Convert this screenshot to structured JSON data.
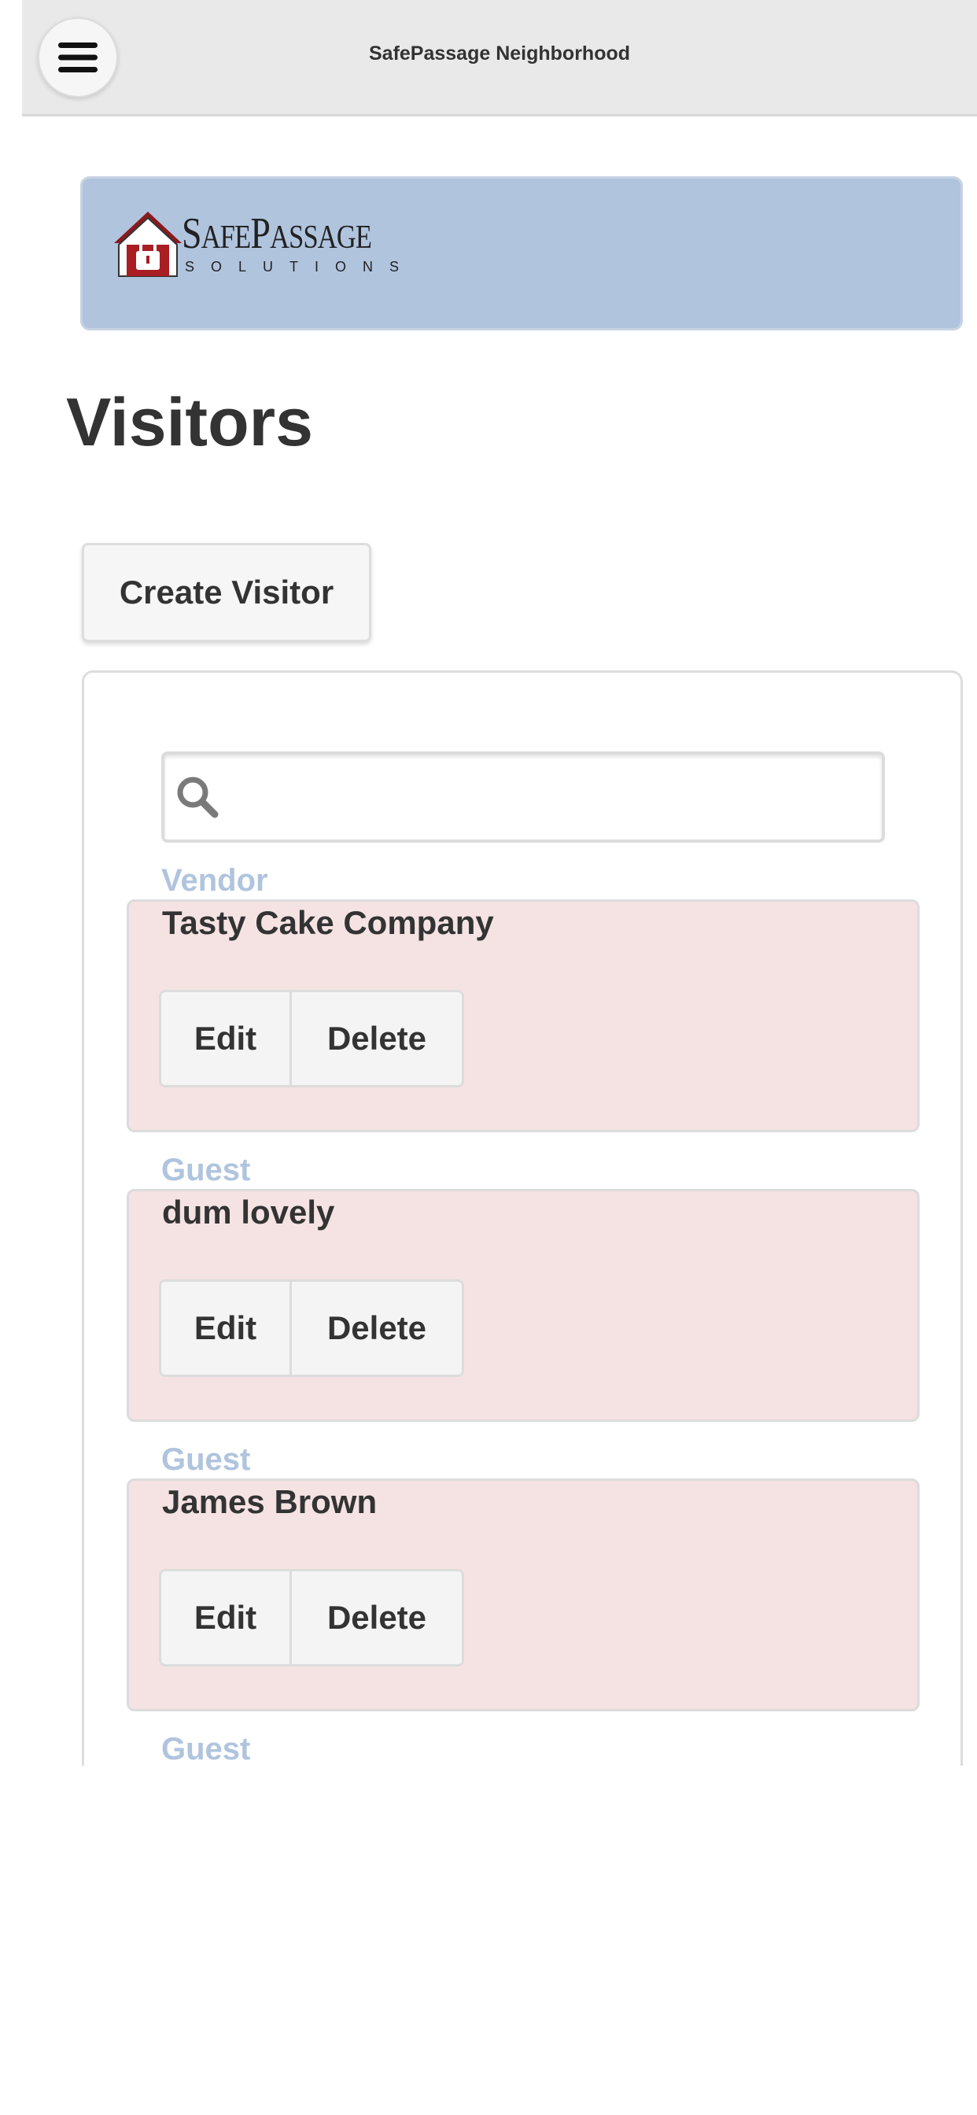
{
  "header": {
    "title": "SafePassage Neighborhood"
  },
  "logo": {
    "main": "SafePassage",
    "sub": "SOLUTIONS"
  },
  "page": {
    "title": "Visitors"
  },
  "actions": {
    "create_label": "Create Visitor"
  },
  "search": {
    "placeholder": "",
    "value": ""
  },
  "visitors": [
    {
      "type": "Vendor",
      "name": "Tasty Cake Company",
      "edit_label": "Edit",
      "delete_label": "Delete"
    },
    {
      "type": "Guest",
      "name": "dum lovely",
      "edit_label": "Edit",
      "delete_label": "Delete"
    },
    {
      "type": "Guest",
      "name": "James Brown",
      "edit_label": "Edit",
      "delete_label": "Delete"
    },
    {
      "type": "Guest"
    }
  ],
  "colors": {
    "header_bg": "#e9e9e9",
    "banner_bg": "#b0c4de",
    "card_bg": "#f5e3e3",
    "type_label": "#b0c4de",
    "logo_red": "#9b1b1f"
  },
  "icons": {
    "menu": "hamburger-icon",
    "search": "search-icon",
    "logo": "house-lock-icon"
  }
}
